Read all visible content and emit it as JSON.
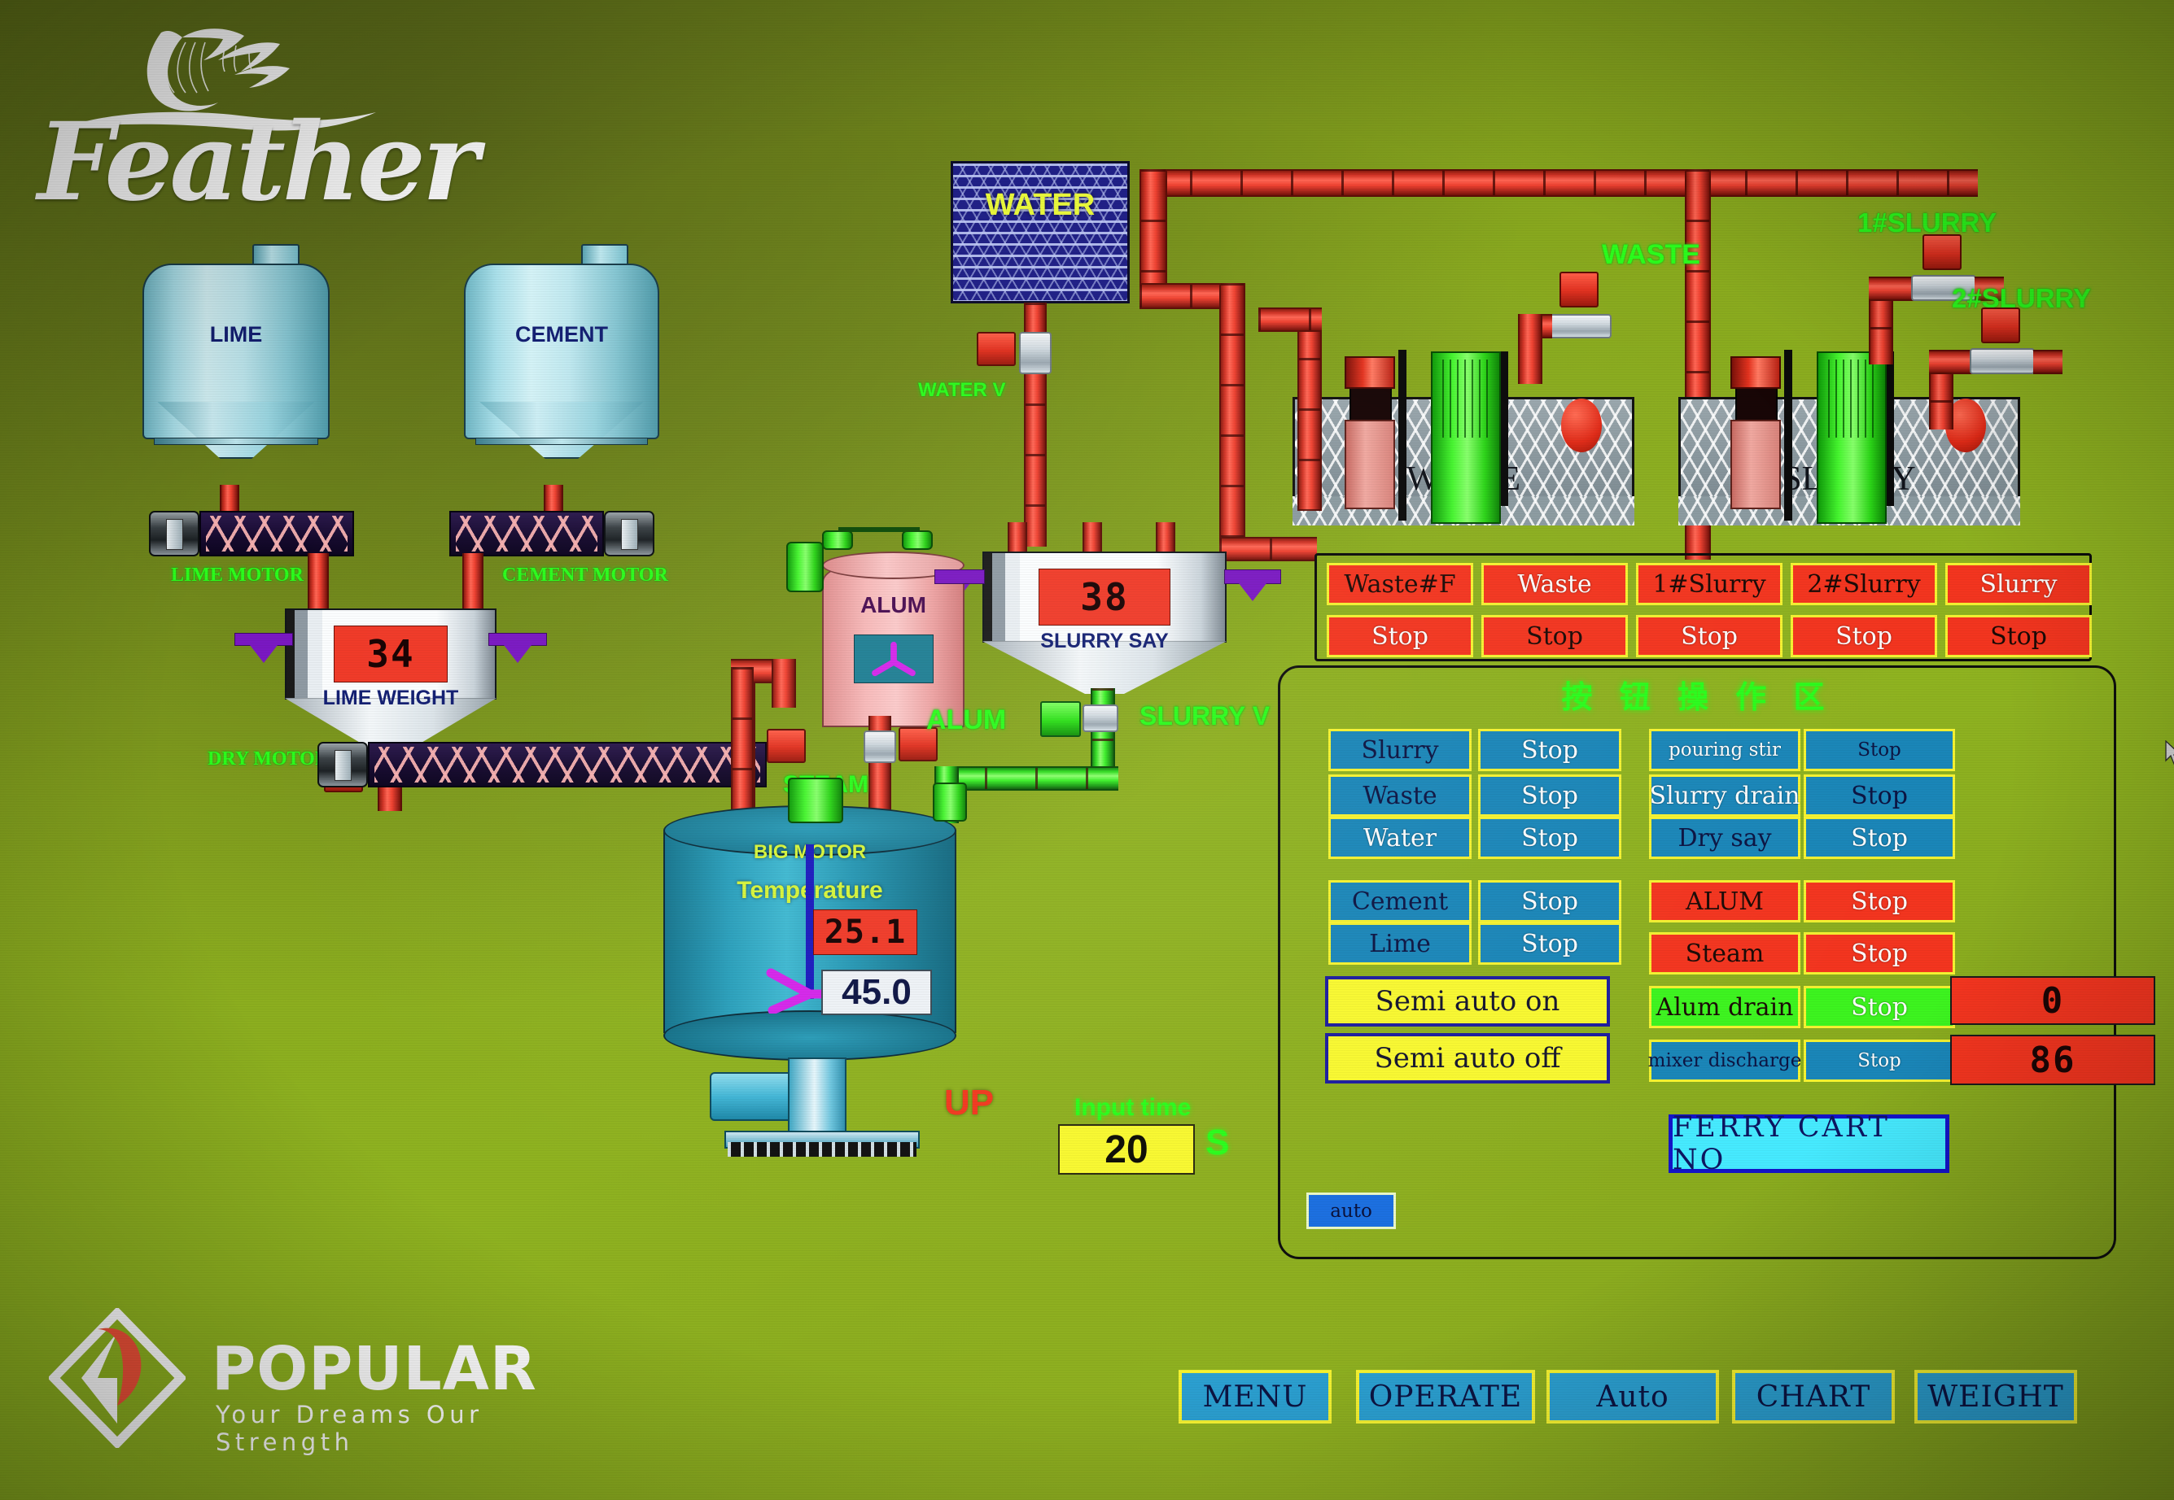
{
  "brand": {
    "feather_name": "Feather",
    "popular_name": "POPULAR",
    "popular_tagline": "Your Dreams Our Strength"
  },
  "vessels": {
    "lime_silo": "LIME",
    "cement_silo": "CEMENT",
    "water_tank": "WATER",
    "alum_tank": "ALUM",
    "waste_pit": "WASTE",
    "slurry_pit": "SLURRY",
    "lime_weight_name": "LIME WEIGHT",
    "lime_weight_value": "34",
    "slurry_say_name": "SLURRY SAY",
    "slurry_say_value": "38"
  },
  "plant_labels": {
    "lime_motor": "LIME MOTOR",
    "cement_motor": "CEMENT MOTOR",
    "dry_motor": "DRY MOTOR",
    "water_valve": "WATER V",
    "waste": "WASTE",
    "slurry_1": "1#SLURRY",
    "slurry_2": "2#SLURRY",
    "alum": "ALUM",
    "steam": "STEAM",
    "slurry_valve": "SLURRY V",
    "big_motor": "BIG MOTOR",
    "temperature": "Temperature",
    "up": "UP"
  },
  "mixer": {
    "temperature_value": "25.1",
    "setpoint_value": "45.0"
  },
  "input_time": {
    "label": "Input time",
    "value": "20",
    "unit": "S"
  },
  "status_panel": {
    "devices": [
      "Waste#F",
      "Waste",
      "1#Slurry",
      "2#Slurry",
      "Slurry"
    ],
    "states": [
      "Stop",
      "Stop",
      "Stop",
      "Stop",
      "Stop"
    ],
    "device_text_styles": [
      "dark",
      "light",
      "dark",
      "dark",
      "light"
    ],
    "state_text_styles": [
      "light",
      "dark",
      "light",
      "light",
      "dark"
    ]
  },
  "button_area": {
    "title": "按 钮 操 作 区",
    "left_column": [
      {
        "name": "Slurry",
        "state": "Stop",
        "name_color": "dark",
        "state_color": "light",
        "bg": "blue"
      },
      {
        "name": "Waste",
        "state": "Stop",
        "name_color": "dark",
        "state_color": "light",
        "bg": "blue"
      },
      {
        "name": "Water",
        "state": "Stop",
        "name_color": "light",
        "state_color": "light",
        "bg": "blue"
      },
      {
        "name": "Cement",
        "state": "Stop",
        "name_color": "dark",
        "state_color": "light",
        "bg": "blue"
      },
      {
        "name": "Lime",
        "state": "Stop",
        "name_color": "dark",
        "state_color": "light",
        "bg": "blue"
      }
    ],
    "right_column": [
      {
        "name": "pouring stir",
        "state": "Stop",
        "name_color": "light",
        "state_color": "dark",
        "bg": "blue",
        "small": true
      },
      {
        "name": "Slurry drain",
        "state": "Stop",
        "name_color": "light",
        "state_color": "dark",
        "bg": "blue",
        "small": false
      },
      {
        "name": "Dry say",
        "state": "Stop",
        "name_color": "dark",
        "state_color": "light",
        "bg": "blue",
        "small": false
      },
      {
        "name": "ALUM",
        "state": "Stop",
        "name_color": "dark",
        "state_color": "light",
        "bg": "red",
        "small": false
      },
      {
        "name": "Steam",
        "state": "Stop",
        "name_color": "dark",
        "state_color": "light",
        "bg": "red",
        "small": false
      },
      {
        "name": "Alum drain",
        "state": "Stop",
        "name_color": "dark",
        "state_color": "light",
        "bg": "lime",
        "small": false
      },
      {
        "name": "mixer discharge",
        "state": "Stop",
        "name_color": "dark",
        "state_color": "light",
        "bg": "blue",
        "small": true
      }
    ],
    "semi_auto_on": "Semi auto on",
    "semi_auto_off": "Semi auto off",
    "ferry_cart_no": "FERRY CART NO",
    "auto_badge": "auto",
    "counter_top": "0",
    "counter_bottom": "86"
  },
  "nav_buttons": [
    "MENU",
    "OPERATE",
    "Auto",
    "CHART",
    "WEIGHT"
  ],
  "colors": {
    "background_green": "#88a81e",
    "pipe_red": "#ef4130",
    "pipe_green": "#38ef25",
    "readout_red": "#f03a28",
    "button_blue": "#1a86b8",
    "button_yellow_border": "#f5f231",
    "label_green": "#2bfc1c",
    "semi_yellow": "#f8f830",
    "ferry_cyan": "#46eaff",
    "nav_blue": "#2b9fd0"
  }
}
